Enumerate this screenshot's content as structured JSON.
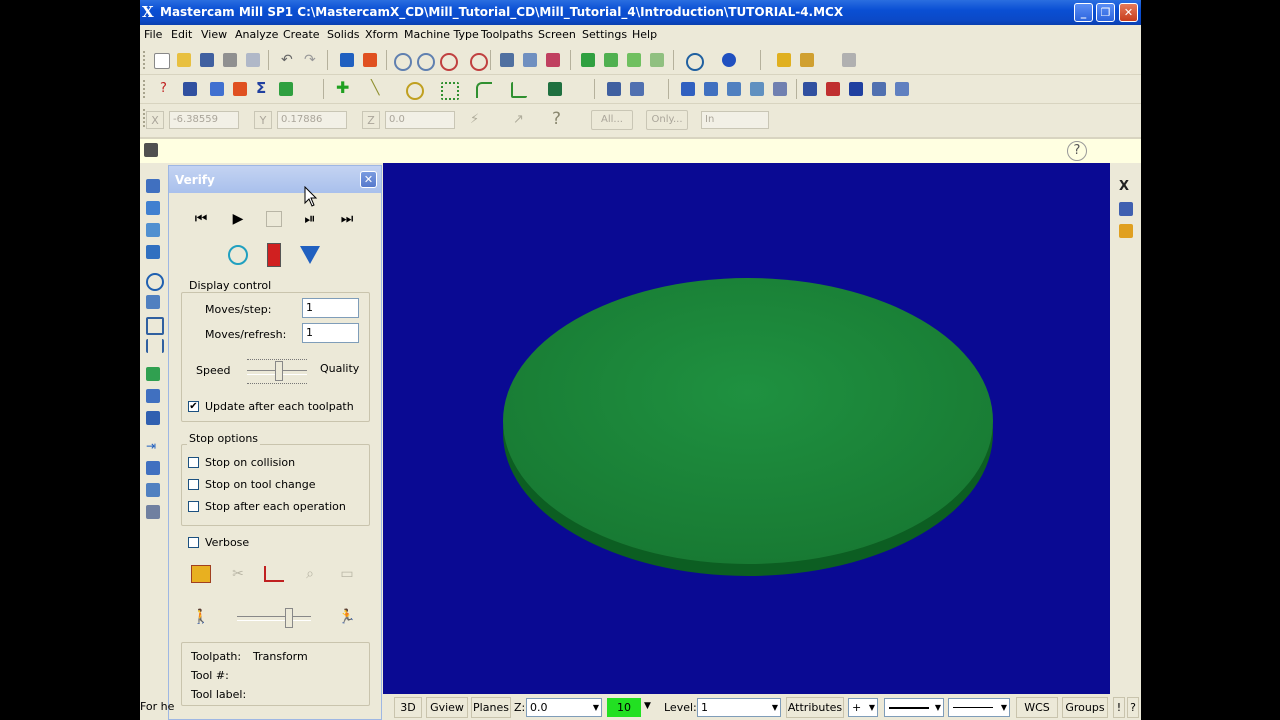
{
  "window": {
    "title": "Mastercam Mill SP1  C:\\MastercamX_CD\\Mill_Tutorial_CD\\Mill_Tutorial_4\\Introduction\\TUTORIAL-4.MCX",
    "minimize": "_",
    "maximize": "❐",
    "close": "✕"
  },
  "menu": [
    "File",
    "Edit",
    "View",
    "Analyze",
    "Create",
    "Solids",
    "Xform",
    "Machine Type",
    "Toolpaths",
    "Screen",
    "Settings",
    "Help"
  ],
  "coords": {
    "x_label": "X",
    "x_value": "-6.38559",
    "y_label": "Y",
    "y_value": "0.17886",
    "z_label": "Z",
    "z_value": "0.0",
    "all_button": "All...",
    "only_button": "Only...",
    "in_value": "In"
  },
  "verify": {
    "title": "Verify",
    "display_control": {
      "label": "Display control",
      "moves_step_label": "Moves/step:",
      "moves_step_value": "1",
      "moves_refresh_label": "Moves/refresh:",
      "moves_refresh_value": "1",
      "speed_label": "Speed",
      "quality_label": "Quality",
      "update_label": "Update after each toolpath",
      "update_checked": true
    },
    "stop_options": {
      "label": "Stop options",
      "collision": "Stop on collision",
      "tool_change": "Stop on tool change",
      "each_operation": "Stop after each operation"
    },
    "verbose_label": "Verbose",
    "info": {
      "toolpath_label": "Toolpath:",
      "toolpath_value": "Transform",
      "tool_num_label": "Tool #:",
      "tool_label_label": "Tool label:"
    }
  },
  "status": {
    "view_3d": "3D",
    "gview": "Gview",
    "planes": "Planes",
    "z_label": "Z:",
    "z_value": "0.0",
    "color_value": "10",
    "level_label": "Level:",
    "level_value": "1",
    "attributes": "Attributes",
    "point_style": "+",
    "wcs": "WCS",
    "groups": "Groups",
    "bang": "!",
    "help": "?"
  },
  "left_hint": "For he",
  "colors": {
    "viewport_bg": "#0a0a93",
    "stock_top": "#1c8a35",
    "stock_side": "#0c5e22"
  }
}
